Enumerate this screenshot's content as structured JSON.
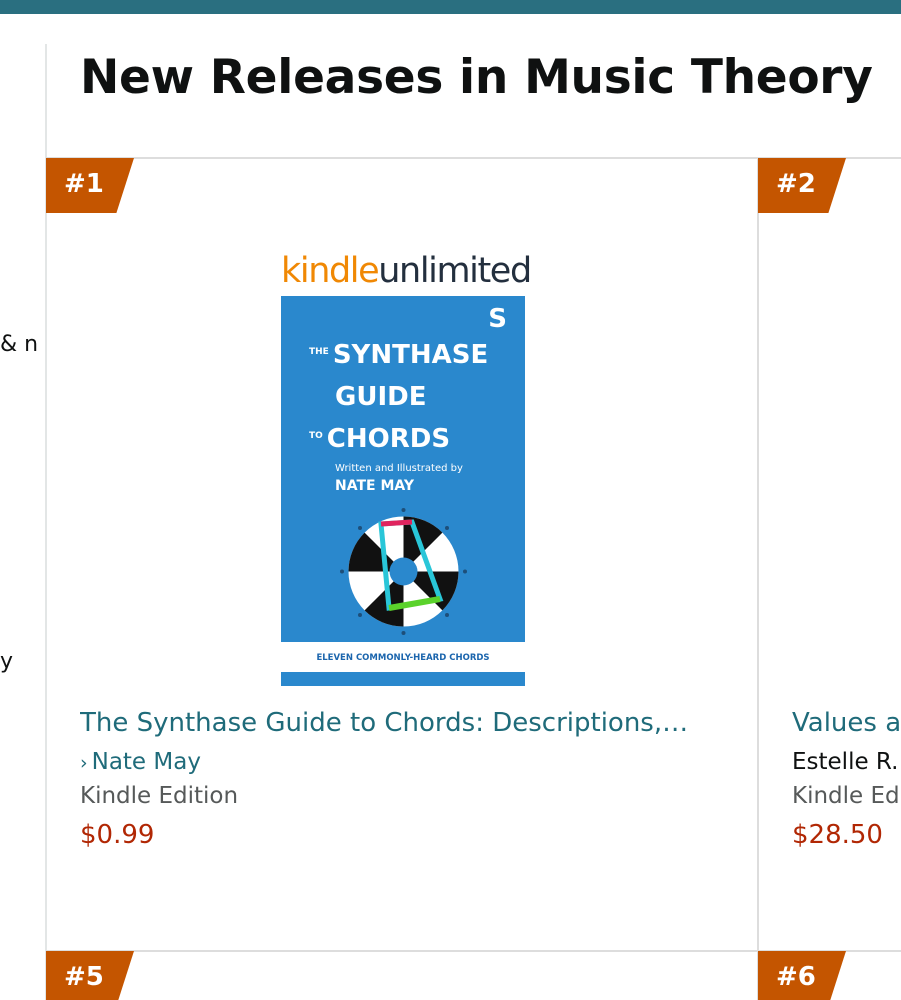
{
  "page": {
    "title": "New Releases in Music Theory"
  },
  "left_rail": {
    "fragments": [
      "n &",
      "y"
    ]
  },
  "icons": {
    "author_link_chevron": "chevron-right-icon",
    "author_link_chevron_glyph": "›"
  },
  "colors": {
    "header_bar": "#2a6f80",
    "rank_badge": "#c45500",
    "link": "#1f6b7a",
    "price": "#b12704",
    "cover_background": "#2a88cd"
  },
  "products": [
    {
      "rank": "#1",
      "badge": {
        "kindle": "kindle",
        "unlimited": "unlimited"
      },
      "cover": {
        "mark": "S",
        "line1_small": "THE",
        "line1": "SYNTHASE",
        "line2": "GUIDE",
        "line3_small": "TO",
        "line3": "CHORDS",
        "subtitle": "Written and Illustrated by",
        "author": "NATE MAY",
        "footer": "ELEVEN COMMONLY-HEARD CHORDS"
      },
      "title": "The Synthase Guide to Chords: Descriptions,…",
      "author": "Nate May",
      "format": "Kindle Edition",
      "price": "$0.99"
    },
    {
      "rank": "#2",
      "title": "Values a",
      "author": "Estelle R.",
      "format": "Kindle Ed",
      "price": "$28.50"
    },
    {
      "rank": "#5"
    },
    {
      "rank": "#6"
    }
  ]
}
